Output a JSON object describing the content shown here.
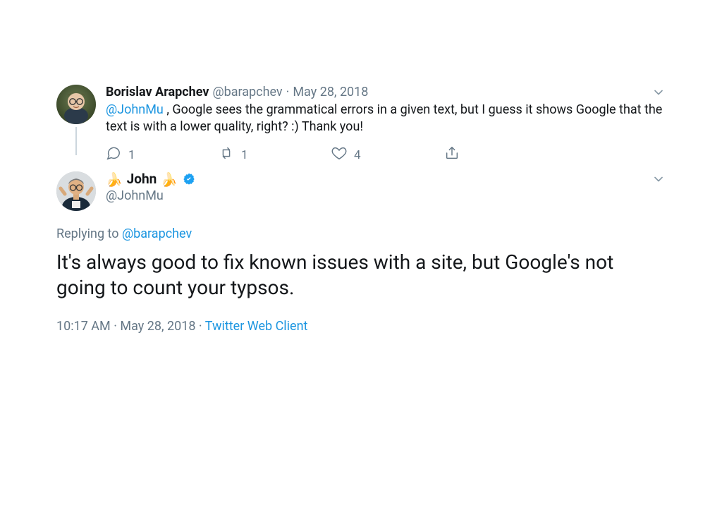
{
  "parent": {
    "display_name": "Borislav Arapchev",
    "handle": "@barapchev",
    "sep1": " · ",
    "date": "May 28, 2018",
    "text_mention": "@JohnMu",
    "text_after": " , Google sees the grammatical errors in a  given text, but I guess it shows Google that the text is with a lower quality, right? :)  Thank you!",
    "reply_count": "1",
    "retweet_count": "1",
    "like_count": "4"
  },
  "main": {
    "emoji_left": "🍌",
    "display_name": "John",
    "emoji_right": "🍌",
    "handle": "@JohnMu",
    "replying_prefix": "Replying to ",
    "replying_to": "@barapchev",
    "text": "It's always good to fix known issues with a site, but Google's not going to count your typsos.",
    "time": "10:17 AM",
    "sep": " · ",
    "date": "May 28, 2018",
    "sep2": " · ",
    "source": "Twitter Web Client"
  }
}
